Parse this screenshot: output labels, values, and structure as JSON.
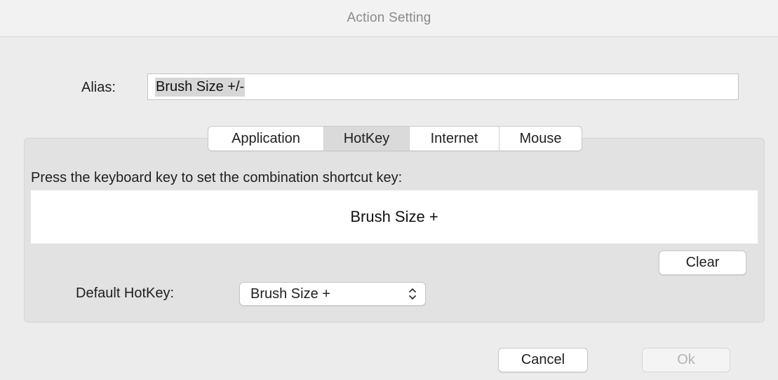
{
  "window": {
    "title": "Action Setting"
  },
  "alias": {
    "label": "Alias:",
    "value": "Brush Size +/-"
  },
  "tabs": [
    {
      "label": "Application",
      "selected": false
    },
    {
      "label": "HotKey",
      "selected": true
    },
    {
      "label": "Internet",
      "selected": false
    },
    {
      "label": "Mouse",
      "selected": false
    }
  ],
  "hotkey": {
    "prompt": "Press the keyboard key to set the combination shortcut key:",
    "display_value": "Brush Size +",
    "clear_label": "Clear",
    "default_label": "Default HotKey:",
    "default_selected": "Brush Size +"
  },
  "footer": {
    "cancel_label": "Cancel",
    "ok_label": "Ok",
    "ok_enabled": false
  },
  "icons": {
    "select_arrows": "chevron-up-down-icon"
  },
  "colors": {
    "window_bg": "#ececec",
    "group_bg": "#e2e2e2",
    "selected_tab_bg": "#dadada",
    "disabled_text": "#b4b4b4"
  }
}
